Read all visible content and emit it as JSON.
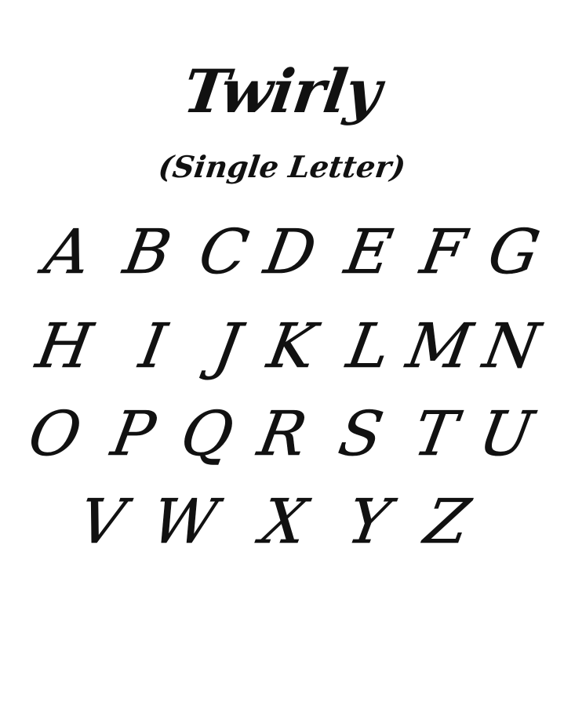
{
  "title": "Twirly",
  "subtitle": "(Single Letter)",
  "letters": [
    "A",
    "B",
    "C",
    "D",
    "E",
    "F",
    "G",
    "H",
    "I",
    "J",
    "K",
    "L",
    "M",
    "N",
    "O",
    "P",
    "Q",
    "R",
    "S",
    "T",
    "U",
    "V",
    "W",
    "X",
    "Y",
    "Z"
  ]
}
